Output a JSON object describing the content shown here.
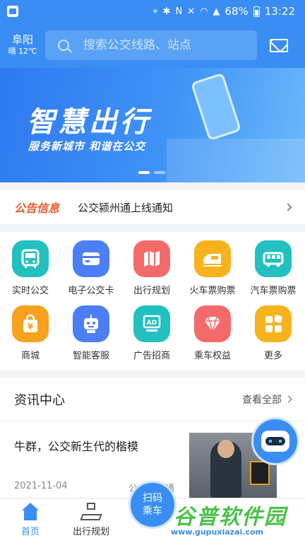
{
  "status_bar": {
    "battery": "68%",
    "time": "13:22"
  },
  "header": {
    "city": "阜阳",
    "weather": "晴 12℃",
    "search_placeholder": "搜索公交线路、站点"
  },
  "banner": {
    "slogan": "智慧出行",
    "subtitle": "服务新城市 和谐在公交"
  },
  "notice": {
    "tag": "公告信息",
    "text": "公交颍州通上线通知"
  },
  "services": [
    {
      "label": "实时公交",
      "icon": "bus-icon",
      "color": "#22c0c0"
    },
    {
      "label": "电子公交卡",
      "icon": "card-icon",
      "color": "#4c7ef5"
    },
    {
      "label": "出行规划",
      "icon": "map-icon",
      "color": "#f46a6a"
    },
    {
      "label": "火车票购票",
      "icon": "train-icon",
      "color": "#f7b21c"
    },
    {
      "label": "汽车票购票",
      "icon": "coach-icon",
      "color": "#22c0c0"
    },
    {
      "label": "商城",
      "icon": "shopping-bag-icon",
      "color": "#f7a11c"
    },
    {
      "label": "智能客服",
      "icon": "robot-icon",
      "color": "#4c7ef5"
    },
    {
      "label": "广告招商",
      "icon": "ad-board-icon",
      "color": "#22c0c0"
    },
    {
      "label": "乘车权益",
      "icon": "diamond-icon",
      "color": "#f46a6a"
    },
    {
      "label": "更多",
      "icon": "grid-icon",
      "color": "#f7b21c"
    }
  ],
  "news": {
    "title": "资讯中心",
    "more": "查看全部",
    "article": {
      "title": "牛群，公交新生代的楷模",
      "date": "2021-11-04",
      "source": "公交颍州通"
    }
  },
  "scan_button": {
    "line1": "扫码",
    "line2": "乘车"
  },
  "tabbar": {
    "home": "首页",
    "plan": "出行规划"
  },
  "watermark": {
    "text": "谷普软件园",
    "url": "www.gupuxiazai.com"
  },
  "colors": {
    "primary": "#3a8df2",
    "notice_tag": "#f05a2a"
  }
}
